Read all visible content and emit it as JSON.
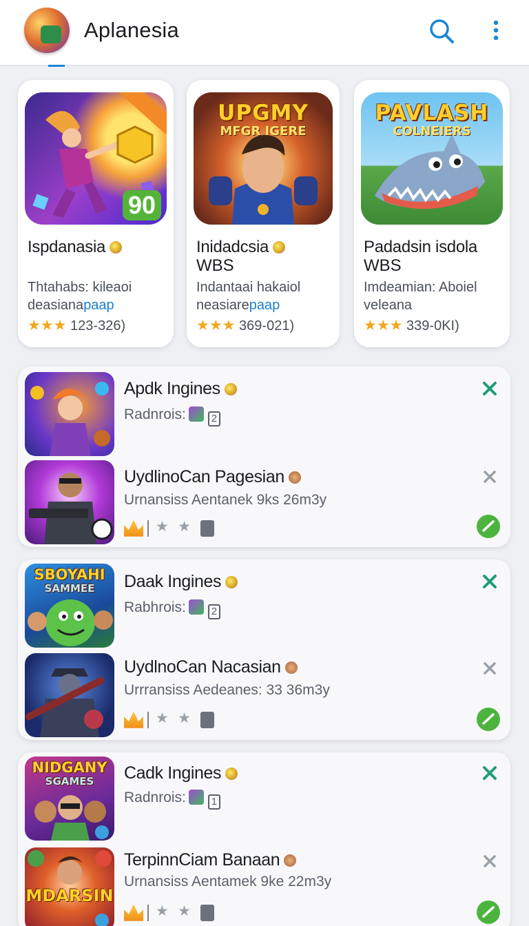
{
  "app": {
    "title": "Aplanesia"
  },
  "colors": {
    "accent": "#1a86d6",
    "star": "#f3a71b",
    "green": "#4cb43e",
    "close_green": "#1f9d74"
  },
  "featured": [
    {
      "art_title": "",
      "art_sub": "",
      "badge": "90",
      "name": "Ispdanasia",
      "sub": "",
      "desc_line1": "Thtahabs: kileaoi",
      "desc_line2_a": "deasiana",
      "desc_line2_link": "paap",
      "rating_text": "123-326)"
    },
    {
      "art_title": "UPGMY",
      "art_sub": "MFGR IGERE",
      "badge": "",
      "name": "Inidadcsia",
      "sub": "WBS",
      "desc_line1": "Indantaai hakaiol",
      "desc_line2_a": "neasiare",
      "desc_line2_link": "paap",
      "rating_text": "369-021)"
    },
    {
      "art_title": "PAVLASH",
      "art_sub": "COLNEIERS",
      "badge": "",
      "name": "Padadsin isdola",
      "sub": "WBS",
      "desc_line1": "Imdeamian: Aboiel",
      "desc_line2_a": "veleana",
      "desc_line2_link": "",
      "rating_text": "339-0KI)"
    }
  ],
  "groups": [
    {
      "top": {
        "title": "Apdk Ingines",
        "meta": "Radnrois:",
        "meta_box": "2",
        "thumb_label": "",
        "thumb_sub": ""
      },
      "bottom": {
        "title": "UydlinoCan Pagesian",
        "meta": "Urnansiss Aentanek 9ks 26m3y",
        "thumb_label": "",
        "thumb_sub": ""
      }
    },
    {
      "top": {
        "title": "Daak Ingines",
        "meta": "Rabhrois:",
        "meta_box": "2",
        "thumb_label": "SBOYAHI",
        "thumb_sub": "SAMMEE"
      },
      "bottom": {
        "title": "UydlnoCan Nacasian",
        "meta": "Urrransiss Aedeanes: 33 36m3y",
        "thumb_label": "",
        "thumb_sub": ""
      }
    },
    {
      "top": {
        "title": "Cadk Ingines",
        "meta": "Radnrois:",
        "meta_box": "1",
        "thumb_label": "NIDGANY",
        "thumb_sub": "SGAMES"
      },
      "bottom": {
        "title": "TerpinnCiam Banaan",
        "meta": "Urnansiss Aentamek 9ke 22m3y",
        "thumb_label": "MDARSIN",
        "thumb_sub": ""
      }
    }
  ]
}
